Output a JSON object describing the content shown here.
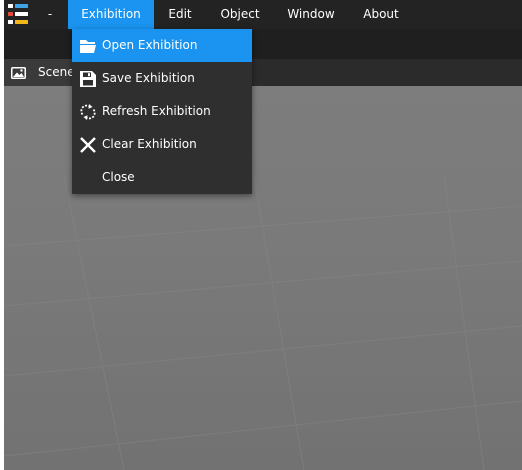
{
  "menubar": {
    "logo_colors": [
      "#3fa3e6",
      "#ffffff",
      "#e14b3c",
      "#ffffff",
      "#ffffff",
      "#f3b91a"
    ],
    "items": [
      {
        "label": "-"
      },
      {
        "label": "Exhibition"
      },
      {
        "label": "Edit"
      },
      {
        "label": "Object"
      },
      {
        "label": "Window"
      },
      {
        "label": "About"
      }
    ]
  },
  "scene_tab": {
    "label": "Scene",
    "icon": "image-icon"
  },
  "exhibition_menu": {
    "items": [
      {
        "label": "Open Exhibition",
        "icon": "folder-open-icon",
        "highlighted": true
      },
      {
        "label": "Save Exhibition",
        "icon": "floppy-disk-icon"
      },
      {
        "label": "Refresh Exhibition",
        "icon": "refresh-icon"
      },
      {
        "label": "Clear Exhibition",
        "icon": "close-x-icon"
      },
      {
        "label": "Close",
        "icon": ""
      }
    ]
  },
  "colors": {
    "accent": "#1a94f0",
    "menubar": "#232323",
    "viewport": "#7a7a7a"
  }
}
